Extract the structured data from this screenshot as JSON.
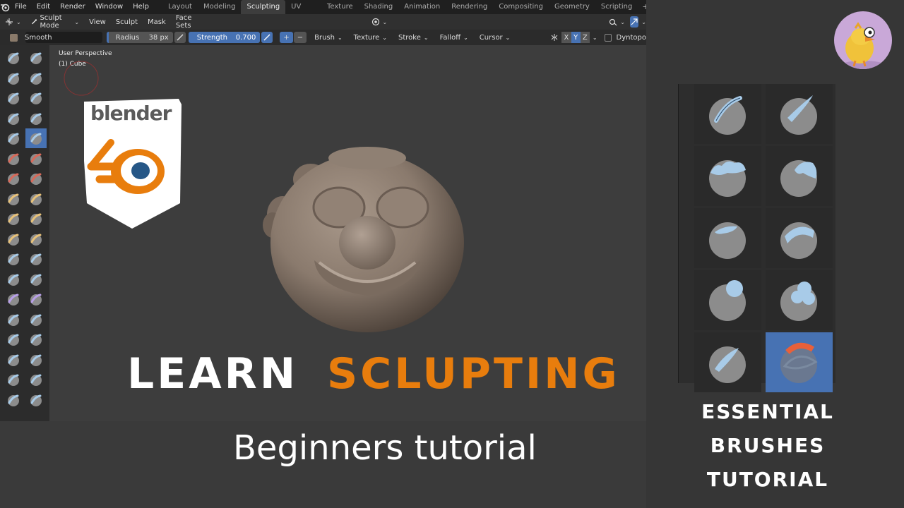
{
  "menu": [
    "File",
    "Edit",
    "Render",
    "Window",
    "Help"
  ],
  "workspaces": [
    "Layout",
    "Modeling",
    "Sculpting",
    "UV Editing",
    "Texture Paint",
    "Shading",
    "Animation",
    "Rendering",
    "Compositing",
    "Geometry Nodes",
    "Scripting"
  ],
  "active_workspace": "Sculpting",
  "header": {
    "mode": "Sculpt Mode",
    "menus": [
      "View",
      "Sculpt",
      "Mask",
      "Face Sets"
    ]
  },
  "tool_settings": {
    "brush_name": "Smooth",
    "radius_label": "Radius",
    "radius_value": "38 px",
    "strength_label": "Strength",
    "strength_value": "0.700",
    "strength_fraction": 0.7,
    "dropdowns": [
      "Brush",
      "Texture",
      "Stroke",
      "Falloff",
      "Cursor"
    ],
    "axes": [
      "X",
      "Y",
      "Z"
    ],
    "dyntopo": "Dyntopo"
  },
  "viewport": {
    "perspective": "User Perspective",
    "object": "(1) Cube"
  },
  "logo_text": "blender",
  "title_word1": "LEARN",
  "title_word2": "SCLUPTING",
  "subtitle": "Beginners tutorial",
  "side_title_line1": "ESSENTIAL BRUSHES",
  "side_title_line2": "TUTORIAL",
  "colors": {
    "accent": "#4772b3",
    "orange": "#e87d0d",
    "brush_blue": "#a8cbe8",
    "brush_gray": "#8c8c8c"
  }
}
